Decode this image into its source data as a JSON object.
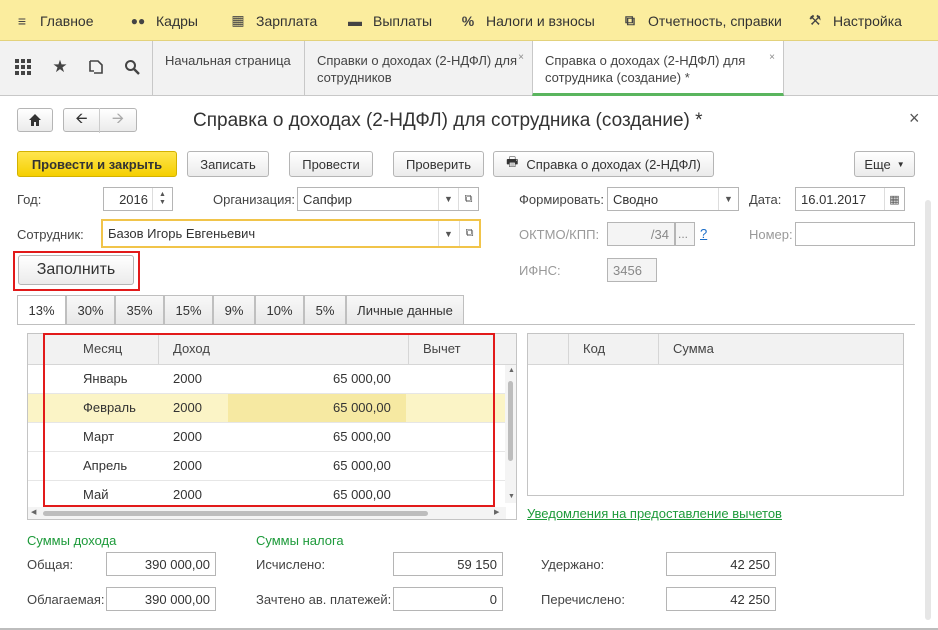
{
  "topmenu": [
    {
      "icon": "≡",
      "icon_name": "hamburger-icon",
      "label": "Главное"
    },
    {
      "icon": "👥",
      "icon_name": "people-icon",
      "label": "Кадры"
    },
    {
      "icon": "▦",
      "icon_name": "calculator-icon",
      "label": "Зарплата"
    },
    {
      "icon": "▬",
      "icon_name": "wallet-icon",
      "label": "Выплаты"
    },
    {
      "icon": "%",
      "icon_name": "percent-icon",
      "label": "Налоги и взносы"
    },
    {
      "icon": "⧉",
      "icon_name": "reports-icon",
      "label": "Отчетность, справки"
    },
    {
      "icon": "🔧",
      "icon_name": "wrench-icon",
      "label": "Настройка"
    }
  ],
  "tabs": [
    {
      "label": "Начальная страница"
    },
    {
      "label": "Справки о доходах (2-НДФЛ) для сотрудников",
      "close": "×"
    },
    {
      "label": "Справка о доходах (2-НДФЛ) для сотрудника (создание) *",
      "close": "×"
    }
  ],
  "form": {
    "title": "Справка о доходах (2-НДФЛ) для сотрудника (создание) *",
    "close": "×",
    "buttons": {
      "post_close": "Провести и закрыть",
      "save": "Записать",
      "post": "Провести",
      "check": "Проверить",
      "print": "Справка о доходах (2-НДФЛ)",
      "more": "Еще",
      "fill": "Заполнить"
    },
    "fields": {
      "year_label": "Год:",
      "year": "2016",
      "org_label": "Организация:",
      "org": "Сапфир",
      "employee_label": "Сотрудник:",
      "employee": "Базов Игорь Евгеньевич",
      "form_label": "Формировать:",
      "form_value": "Сводно",
      "date_label": "Дата:",
      "date": "16.01.2017",
      "oktmo_label": "ОКТМО/КПП:",
      "oktmo": "/34",
      "oktmo_help": "?",
      "number_label": "Номер:",
      "number": "",
      "ifns_label": "ИФНС:",
      "ifns": "3456"
    },
    "rate_tabs": [
      "13%",
      "30%",
      "35%",
      "15%",
      "9%",
      "10%",
      "5%",
      "Личные данные"
    ],
    "income_table": {
      "headers": [
        "Месяц",
        "Доход",
        "Вычет"
      ],
      "rows": [
        {
          "month": "Январь",
          "code": "2000",
          "amount": "65 000,00"
        },
        {
          "month": "Февраль",
          "code": "2000",
          "amount": "65 000,00"
        },
        {
          "month": "Март",
          "code": "2000",
          "amount": "65 000,00"
        },
        {
          "month": "Апрель",
          "code": "2000",
          "amount": "65 000,00"
        },
        {
          "month": "Май",
          "code": "2000",
          "amount": "65 000,00"
        }
      ]
    },
    "deduction_table": {
      "headers": [
        "Код",
        "Сумма"
      ]
    },
    "deduction_link": "Уведомления на предоставление вычетов",
    "income_sums": {
      "title": "Суммы дохода",
      "total_label": "Общая:",
      "total": "390 000,00",
      "taxable_label": "Облагаемая:",
      "taxable": "390 000,00"
    },
    "tax_sums": {
      "title": "Суммы налога",
      "calculated_label": "Исчислено:",
      "calculated": "59 150",
      "advance_label": "Зачтено ав. платежей:",
      "advance": "0",
      "withheld_label": "Удержано:",
      "withheld": "42 250",
      "transferred_label": "Перечислено:",
      "transferred": "42 250"
    }
  }
}
